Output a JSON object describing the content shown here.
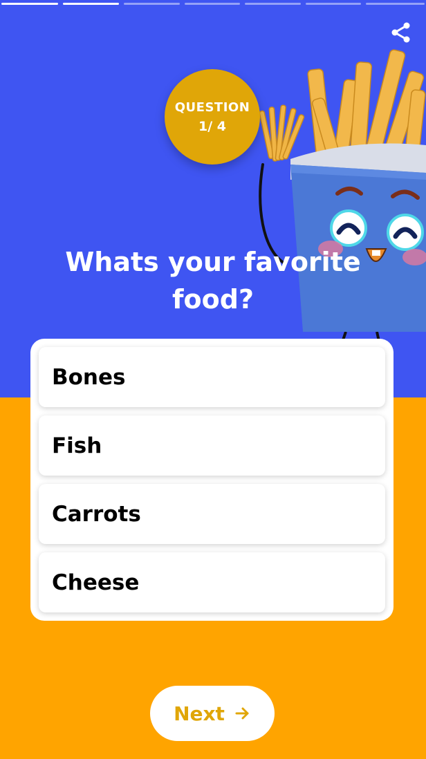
{
  "progress": {
    "total_steps": 7,
    "completed_steps": 2
  },
  "badge": {
    "line1": "QUESTION",
    "line2": "1/ 4"
  },
  "question": {
    "text": "Whats your favorite food?"
  },
  "options": [
    {
      "label": "Bones"
    },
    {
      "label": "Fish"
    },
    {
      "label": "Carrots"
    },
    {
      "label": "Cheese"
    }
  ],
  "next_button": {
    "label": "Next",
    "icon": "arrow-right-icon"
  },
  "share": {
    "icon": "share-icon"
  },
  "colors": {
    "primary_blue": "#3F55F2",
    "accent_orange": "#FFA400",
    "badge_gold": "#E0A608",
    "white": "#FFFFFF"
  }
}
